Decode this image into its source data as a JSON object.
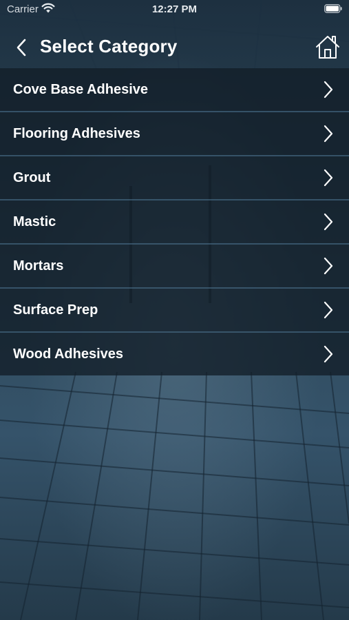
{
  "status_bar": {
    "carrier": "Carrier",
    "time": "12:27 PM",
    "wifi_icon": "wifi-icon",
    "battery_icon": "battery-icon"
  },
  "nav": {
    "title": "Select Category",
    "back_icon": "chevron-left-icon",
    "home_icon": "home-icon"
  },
  "categories": [
    {
      "label": "Cove Base Adhesive"
    },
    {
      "label": "Flooring Adhesives"
    },
    {
      "label": "Grout"
    },
    {
      "label": "Mastic"
    },
    {
      "label": "Mortars"
    },
    {
      "label": "Surface Prep"
    },
    {
      "label": "Wood Adhesives"
    }
  ],
  "colors": {
    "background": "#2c4556",
    "list_row": "#121e28",
    "separator": "#50789a",
    "text": "#ffffff"
  }
}
